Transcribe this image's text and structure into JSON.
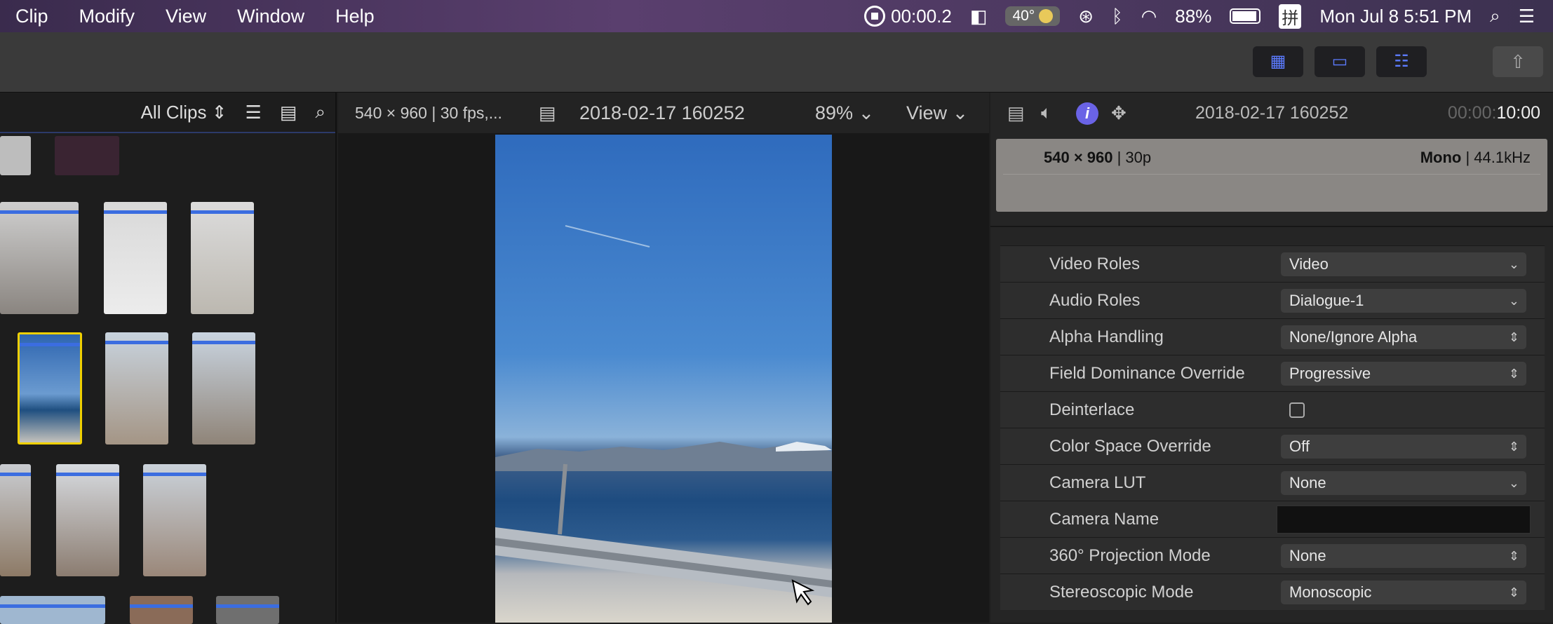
{
  "menubar": {
    "items": [
      "Clip",
      "Modify",
      "View",
      "Window",
      "Help"
    ],
    "recording_time": "00:00.2",
    "temperature": "40°",
    "battery": "88%",
    "ime": "拼",
    "datetime": "Mon Jul 8  5:51 PM"
  },
  "browser": {
    "filter_label": "All Clips"
  },
  "viewer": {
    "format": "540 × 960 | 30 fps,...",
    "clip_name": "2018-02-17 160252",
    "zoom": "89%",
    "view_label": "View"
  },
  "inspector": {
    "clip_name": "2018-02-17 160252",
    "timecode_dim": "00:00:",
    "timecode_bright": "10:00",
    "info_video": "540 × 960",
    "info_video_rate": " | 30p",
    "info_audio": "Mono",
    "info_audio_rate": " | 44.1",
    "info_audio_unit": "kHz",
    "properties": [
      {
        "label": "Video Roles",
        "value": "Video",
        "control": "popup"
      },
      {
        "label": "Audio Roles",
        "value": "Dialogue-1",
        "control": "popup"
      },
      {
        "label": "Alpha Handling",
        "value": "None/Ignore Alpha",
        "control": "stepper"
      },
      {
        "label": "Field Dominance Override",
        "value": "Progressive",
        "control": "stepper"
      },
      {
        "label": "Deinterlace",
        "value": "",
        "control": "checkbox"
      },
      {
        "label": "Color Space Override",
        "value": "Off",
        "control": "stepper"
      },
      {
        "label": "Camera LUT",
        "value": "None",
        "control": "popup"
      },
      {
        "label": "Camera Name",
        "value": "",
        "control": "text"
      },
      {
        "label": "360° Projection Mode",
        "value": "None",
        "control": "stepper"
      },
      {
        "label": "Stereoscopic Mode",
        "value": "Monoscopic",
        "control": "stepper"
      }
    ]
  },
  "colors": {
    "accent": "#5c7bff",
    "selection": "#f0d000",
    "clip_bar": "#3b6de0"
  }
}
